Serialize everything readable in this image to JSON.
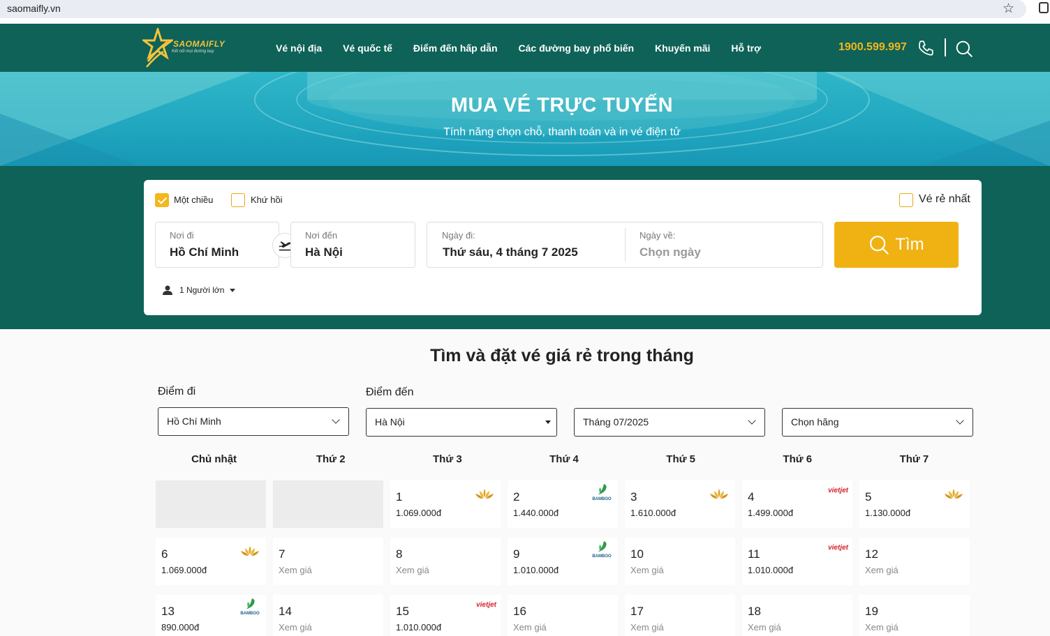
{
  "browser": {
    "url": "saomaifly.vn"
  },
  "header": {
    "brand": "SAOMAIFLY",
    "tagline": "Kết nối mọi đường bay",
    "nav": [
      "Vé nội địa",
      "Vé quốc tế",
      "Điểm đến hấp dẫn",
      "Các đường bay phổ biến",
      "Khuyến mãi",
      "Hỗ trợ"
    ],
    "hotline": "1900.599.997",
    "colors": {
      "bg": "#0e6257",
      "accent": "#f5b71b"
    }
  },
  "banner": {
    "title": "MUA VÉ TRỰC TUYẾN",
    "subtitle": "Tính năng chọn chỗ, thanh toán và in vé điện tử"
  },
  "search": {
    "one_way": {
      "label": "Một chiều",
      "checked": true
    },
    "round_trip": {
      "label": "Khứ hồi",
      "checked": false
    },
    "cheapest": {
      "label": "Vé rẻ nhất",
      "checked": false
    },
    "from": {
      "label": "Nơi đi",
      "value": "Hồ Chí Minh"
    },
    "to": {
      "label": "Nơi đến",
      "value": "Hà Nội"
    },
    "depart": {
      "label": "Ngày đi:",
      "value": "Thứ sáu, 4 tháng 7 2025"
    },
    "return": {
      "label": "Ngày về:",
      "placeholder": "Chọn ngày"
    },
    "button": "Tìm",
    "passengers": "1 Người lớn"
  },
  "calendar": {
    "title": "Tìm và đặt vé giá rẻ trong tháng",
    "from_label": "Điểm đi",
    "to_label": "Điểm đến",
    "from_value": "Hồ Chí Minh",
    "to_value": "Hà Nội",
    "month_value": "Tháng 07/2025",
    "airline_value": "Chọn hãng",
    "weekdays": [
      "Chủ nhật",
      "Thứ 2",
      "Thứ 3",
      "Thứ 4",
      "Thứ 5",
      "Thứ 6",
      "Thứ 7"
    ],
    "days": [
      {
        "day": "",
        "price": "",
        "airline": "",
        "empty": true
      },
      {
        "day": "",
        "price": "",
        "airline": "",
        "empty": true
      },
      {
        "day": "1",
        "price": "1.069.000đ",
        "airline": "vietnam-airlines"
      },
      {
        "day": "2",
        "price": "1.440.000đ",
        "airline": "bamboo"
      },
      {
        "day": "3",
        "price": "1.610.000đ",
        "airline": "vietnam-airlines"
      },
      {
        "day": "4",
        "price": "1.499.000đ",
        "airline": "vietjet"
      },
      {
        "day": "5",
        "price": "1.130.000đ",
        "airline": "vietnam-airlines"
      },
      {
        "day": "6",
        "price": "1.069.000đ",
        "airline": "vietnam-airlines"
      },
      {
        "day": "7",
        "price": "Xem giá",
        "airline": ""
      },
      {
        "day": "8",
        "price": "Xem giá",
        "airline": ""
      },
      {
        "day": "9",
        "price": "1.010.000đ",
        "airline": "bamboo"
      },
      {
        "day": "10",
        "price": "Xem giá",
        "airline": ""
      },
      {
        "day": "11",
        "price": "1.010.000đ",
        "airline": "vietjet"
      },
      {
        "day": "12",
        "price": "Xem giá",
        "airline": ""
      },
      {
        "day": "13",
        "price": "890.000đ",
        "airline": "bamboo"
      },
      {
        "day": "14",
        "price": "Xem giá",
        "airline": ""
      },
      {
        "day": "15",
        "price": "1.010.000đ",
        "airline": "vietjet"
      },
      {
        "day": "16",
        "price": "Xem giá",
        "airline": ""
      },
      {
        "day": "17",
        "price": "Xem giá",
        "airline": ""
      },
      {
        "day": "18",
        "price": "Xem giá",
        "airline": ""
      },
      {
        "day": "19",
        "price": "Xem giá",
        "airline": ""
      }
    ],
    "vietjet_mark": "vietjet",
    "bamboo_mark": "BAMBOO"
  }
}
